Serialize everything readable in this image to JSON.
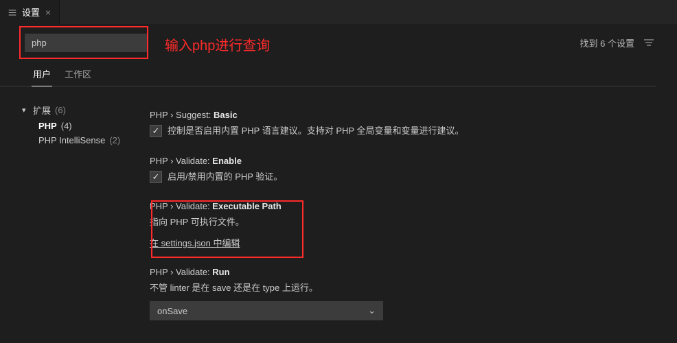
{
  "tab": {
    "title": "设置"
  },
  "search": {
    "value": "php",
    "result_text": "找到 6 个设置"
  },
  "annotations": {
    "search_hint": "输入php进行查询"
  },
  "scope_tabs": {
    "user": "用户",
    "workspace": "工作区"
  },
  "tree": {
    "extensions": {
      "label": "扩展",
      "count": "(6)"
    },
    "php": {
      "label": "PHP",
      "count": "(4)"
    },
    "intellisense": {
      "label": "PHP IntelliSense",
      "count": "(2)"
    }
  },
  "settings": {
    "suggest_basic": {
      "crumb": "PHP › Suggest: ",
      "name": "Basic",
      "desc": "控制是否启用内置 PHP 语言建议。支持对 PHP 全局变量和变量进行建议。"
    },
    "validate_enable": {
      "crumb": "PHP › Validate: ",
      "name": "Enable",
      "desc": "启用/禁用内置的 PHP 验证。"
    },
    "validate_exec": {
      "crumb": "PHP › Validate: ",
      "name": "Executable Path",
      "desc": "指向 PHP 可执行文件。",
      "link": "在 settings.json 中编辑"
    },
    "validate_run": {
      "crumb": "PHP › Validate: ",
      "name": "Run",
      "desc": "不管 linter 是在 save 还是在 type 上运行。",
      "value": "onSave"
    }
  }
}
